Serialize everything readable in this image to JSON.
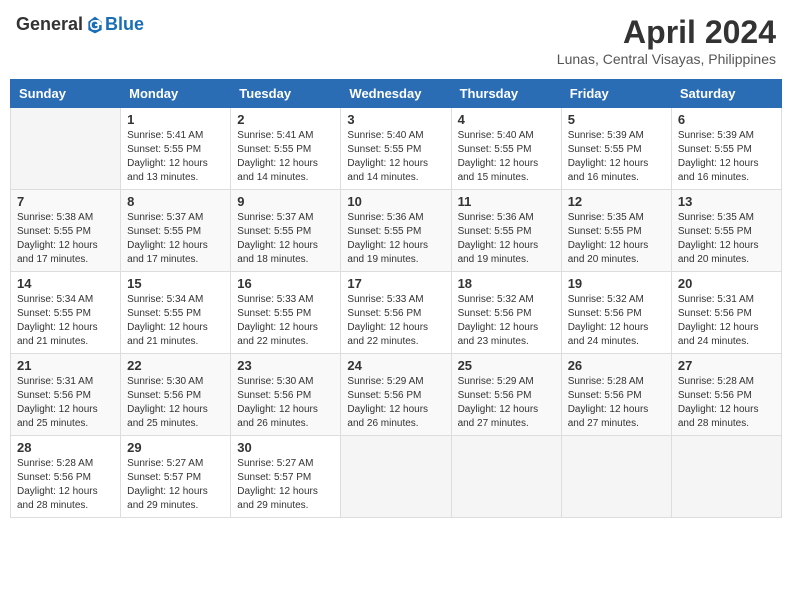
{
  "header": {
    "logo_general": "General",
    "logo_blue": "Blue",
    "month_title": "April 2024",
    "location": "Lunas, Central Visayas, Philippines"
  },
  "calendar": {
    "days_of_week": [
      "Sunday",
      "Monday",
      "Tuesday",
      "Wednesday",
      "Thursday",
      "Friday",
      "Saturday"
    ],
    "weeks": [
      [
        {
          "day": "",
          "info": ""
        },
        {
          "day": "1",
          "info": "Sunrise: 5:41 AM\nSunset: 5:55 PM\nDaylight: 12 hours\nand 13 minutes."
        },
        {
          "day": "2",
          "info": "Sunrise: 5:41 AM\nSunset: 5:55 PM\nDaylight: 12 hours\nand 14 minutes."
        },
        {
          "day": "3",
          "info": "Sunrise: 5:40 AM\nSunset: 5:55 PM\nDaylight: 12 hours\nand 14 minutes."
        },
        {
          "day": "4",
          "info": "Sunrise: 5:40 AM\nSunset: 5:55 PM\nDaylight: 12 hours\nand 15 minutes."
        },
        {
          "day": "5",
          "info": "Sunrise: 5:39 AM\nSunset: 5:55 PM\nDaylight: 12 hours\nand 16 minutes."
        },
        {
          "day": "6",
          "info": "Sunrise: 5:39 AM\nSunset: 5:55 PM\nDaylight: 12 hours\nand 16 minutes."
        }
      ],
      [
        {
          "day": "7",
          "info": "Sunrise: 5:38 AM\nSunset: 5:55 PM\nDaylight: 12 hours\nand 17 minutes."
        },
        {
          "day": "8",
          "info": "Sunrise: 5:37 AM\nSunset: 5:55 PM\nDaylight: 12 hours\nand 17 minutes."
        },
        {
          "day": "9",
          "info": "Sunrise: 5:37 AM\nSunset: 5:55 PM\nDaylight: 12 hours\nand 18 minutes."
        },
        {
          "day": "10",
          "info": "Sunrise: 5:36 AM\nSunset: 5:55 PM\nDaylight: 12 hours\nand 19 minutes."
        },
        {
          "day": "11",
          "info": "Sunrise: 5:36 AM\nSunset: 5:55 PM\nDaylight: 12 hours\nand 19 minutes."
        },
        {
          "day": "12",
          "info": "Sunrise: 5:35 AM\nSunset: 5:55 PM\nDaylight: 12 hours\nand 20 minutes."
        },
        {
          "day": "13",
          "info": "Sunrise: 5:35 AM\nSunset: 5:55 PM\nDaylight: 12 hours\nand 20 minutes."
        }
      ],
      [
        {
          "day": "14",
          "info": "Sunrise: 5:34 AM\nSunset: 5:55 PM\nDaylight: 12 hours\nand 21 minutes."
        },
        {
          "day": "15",
          "info": "Sunrise: 5:34 AM\nSunset: 5:55 PM\nDaylight: 12 hours\nand 21 minutes."
        },
        {
          "day": "16",
          "info": "Sunrise: 5:33 AM\nSunset: 5:55 PM\nDaylight: 12 hours\nand 22 minutes."
        },
        {
          "day": "17",
          "info": "Sunrise: 5:33 AM\nSunset: 5:56 PM\nDaylight: 12 hours\nand 22 minutes."
        },
        {
          "day": "18",
          "info": "Sunrise: 5:32 AM\nSunset: 5:56 PM\nDaylight: 12 hours\nand 23 minutes."
        },
        {
          "day": "19",
          "info": "Sunrise: 5:32 AM\nSunset: 5:56 PM\nDaylight: 12 hours\nand 24 minutes."
        },
        {
          "day": "20",
          "info": "Sunrise: 5:31 AM\nSunset: 5:56 PM\nDaylight: 12 hours\nand 24 minutes."
        }
      ],
      [
        {
          "day": "21",
          "info": "Sunrise: 5:31 AM\nSunset: 5:56 PM\nDaylight: 12 hours\nand 25 minutes."
        },
        {
          "day": "22",
          "info": "Sunrise: 5:30 AM\nSunset: 5:56 PM\nDaylight: 12 hours\nand 25 minutes."
        },
        {
          "day": "23",
          "info": "Sunrise: 5:30 AM\nSunset: 5:56 PM\nDaylight: 12 hours\nand 26 minutes."
        },
        {
          "day": "24",
          "info": "Sunrise: 5:29 AM\nSunset: 5:56 PM\nDaylight: 12 hours\nand 26 minutes."
        },
        {
          "day": "25",
          "info": "Sunrise: 5:29 AM\nSunset: 5:56 PM\nDaylight: 12 hours\nand 27 minutes."
        },
        {
          "day": "26",
          "info": "Sunrise: 5:28 AM\nSunset: 5:56 PM\nDaylight: 12 hours\nand 27 minutes."
        },
        {
          "day": "27",
          "info": "Sunrise: 5:28 AM\nSunset: 5:56 PM\nDaylight: 12 hours\nand 28 minutes."
        }
      ],
      [
        {
          "day": "28",
          "info": "Sunrise: 5:28 AM\nSunset: 5:56 PM\nDaylight: 12 hours\nand 28 minutes."
        },
        {
          "day": "29",
          "info": "Sunrise: 5:27 AM\nSunset: 5:57 PM\nDaylight: 12 hours\nand 29 minutes."
        },
        {
          "day": "30",
          "info": "Sunrise: 5:27 AM\nSunset: 5:57 PM\nDaylight: 12 hours\nand 29 minutes."
        },
        {
          "day": "",
          "info": ""
        },
        {
          "day": "",
          "info": ""
        },
        {
          "day": "",
          "info": ""
        },
        {
          "day": "",
          "info": ""
        }
      ]
    ]
  }
}
